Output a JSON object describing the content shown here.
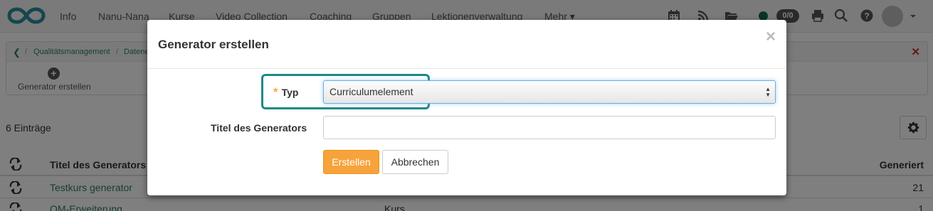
{
  "topnav": {
    "items": [
      "Info",
      "Nanu-Nana",
      "Kurse",
      "Video Collection",
      "Coaching",
      "Gruppen",
      "Lektionenverwaltung",
      "Mehr"
    ],
    "icons": [
      "calendar-icon",
      "rss-icon",
      "folder-icon",
      "status-dot-icon",
      "print-icon",
      "search-icon",
      "help-icon",
      "avatar"
    ],
    "badge": "0/0",
    "colors": {
      "logo": "#2c8c9c",
      "status": "#146c43",
      "badge": "#555555"
    }
  },
  "toolbar": {
    "breadcrumbs": [
      "Qualitätsmanagement",
      "Datene"
    ],
    "add_generator_label": "Generator erstellen"
  },
  "table": {
    "count_label": "6 Einträge",
    "headers": {
      "title": "Titel des Generators",
      "generated": "Generiert"
    },
    "rows": [
      {
        "title": "Testkurs generator",
        "type": "",
        "generated": "21"
      },
      {
        "title": "QM-Erweiterung",
        "type": "Kurs",
        "generated": "1"
      }
    ]
  },
  "modal": {
    "title": "Generator erstellen",
    "close": "×",
    "type_label": "Typ",
    "type_value": "Curriculumelement",
    "generator_title_label": "Titel des Generators",
    "generator_title_value": "",
    "create_button": "Erstellen",
    "cancel_button": "Abbrechen",
    "colors": {
      "primary_button": "#f7a33c",
      "highlight": "#1b8a85",
      "required_star": "#f0ad4e"
    }
  }
}
